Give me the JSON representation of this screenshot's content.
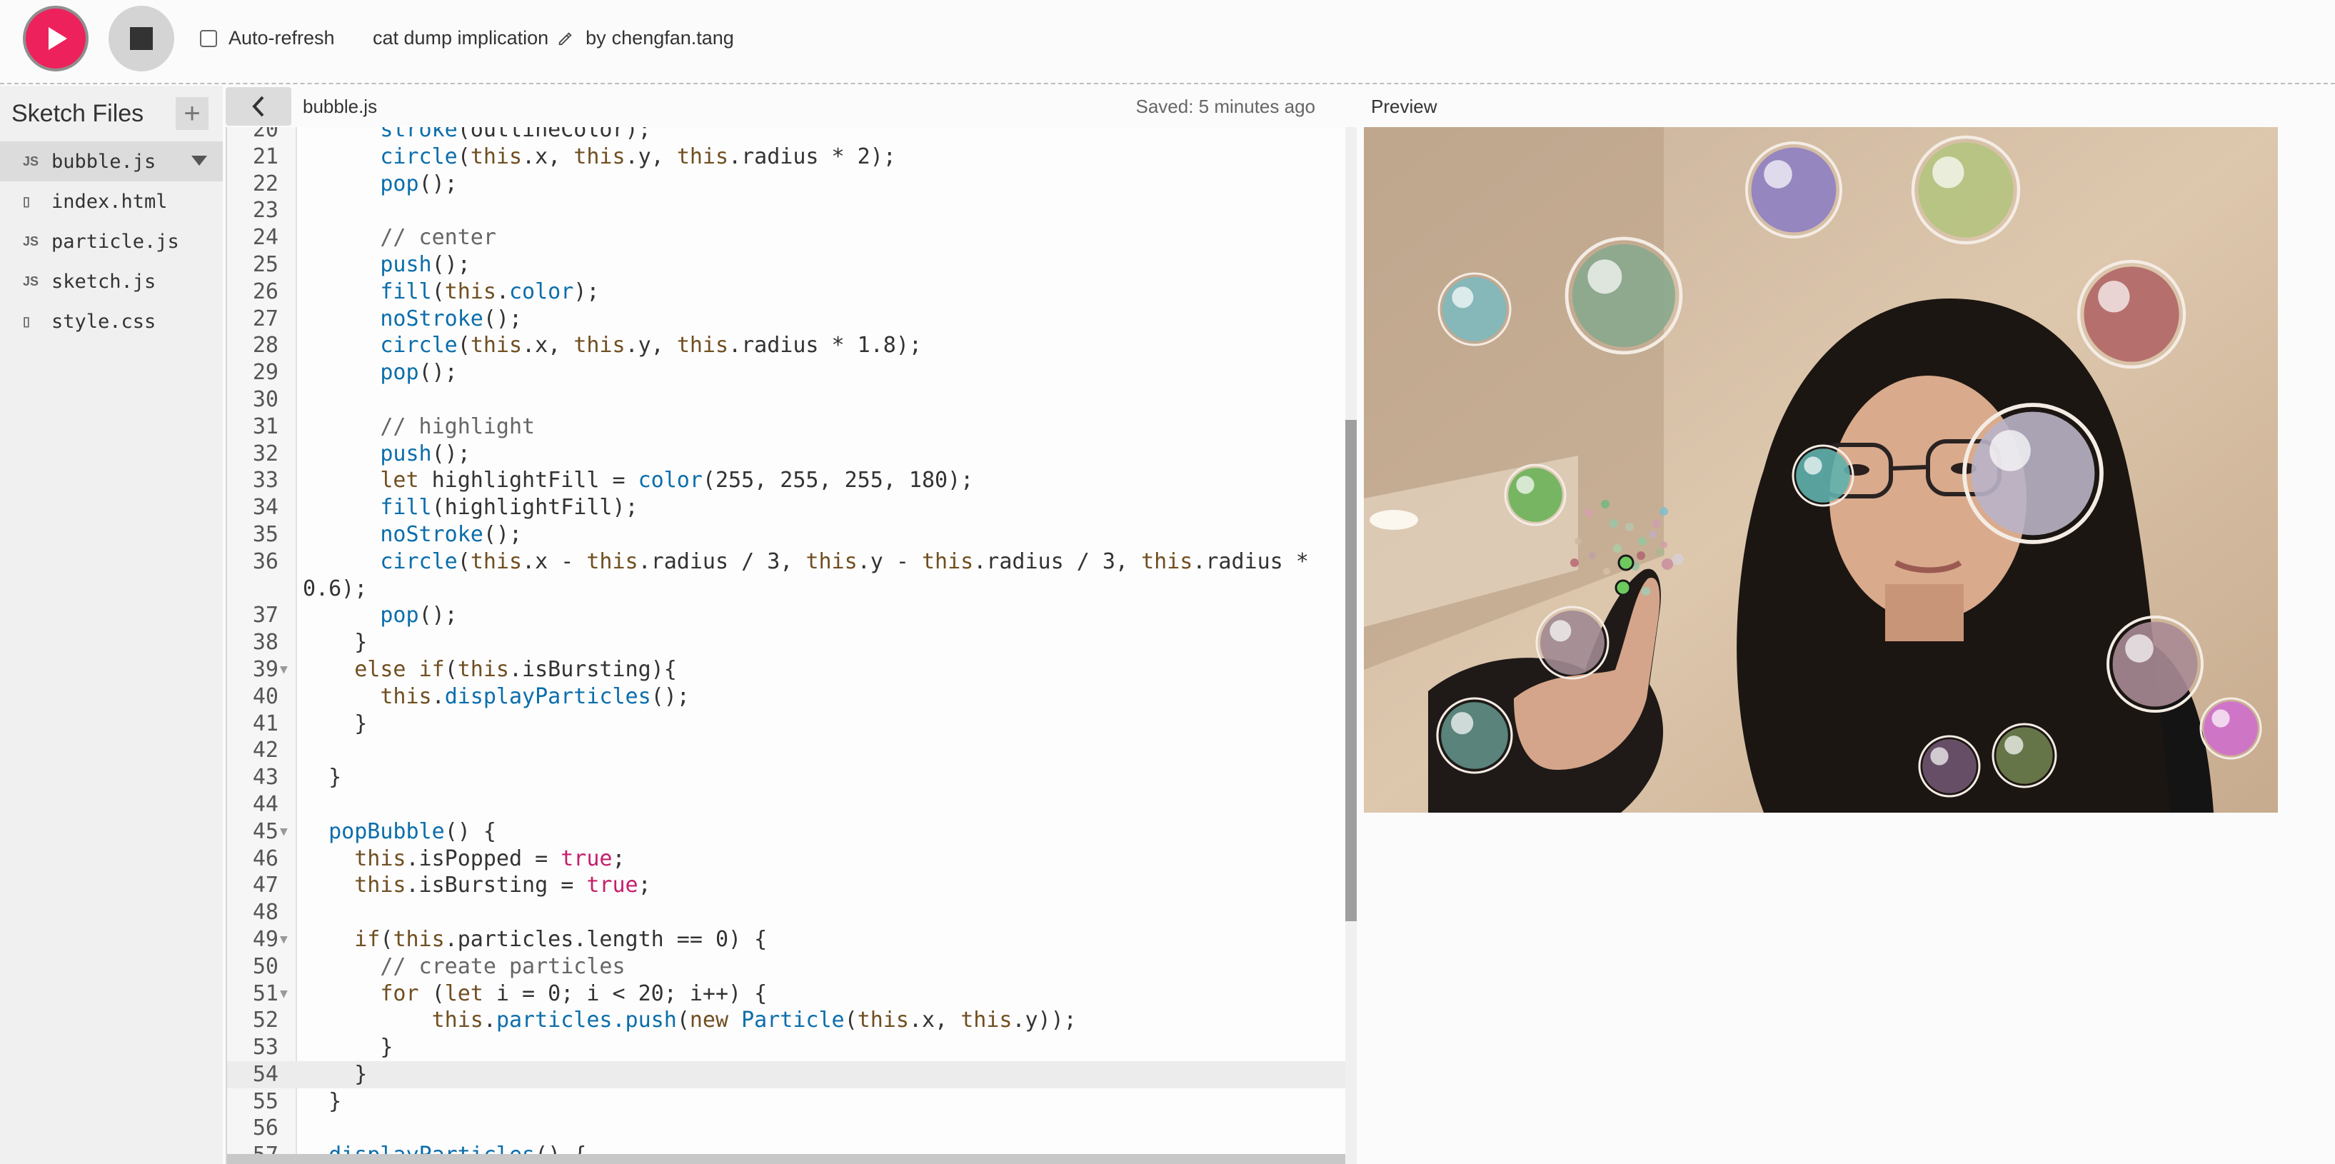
{
  "toolbar": {
    "play_icon": "play-icon",
    "stop_icon": "stop-icon",
    "auto_refresh_label": "Auto-refresh",
    "auto_refresh_checked": false,
    "project_name": "cat dump implication",
    "edit_icon": "pencil-icon",
    "by_label": "by",
    "author": "chengfan.tang"
  },
  "sidebar": {
    "title": "Sketch Files",
    "add_icon": "+",
    "files": [
      {
        "name": "bubble.js",
        "icon": "JS",
        "active": true
      },
      {
        "name": "index.html",
        "icon": "▯",
        "active": false
      },
      {
        "name": "particle.js",
        "icon": "JS",
        "active": false
      },
      {
        "name": "sketch.js",
        "icon": "JS",
        "active": false
      },
      {
        "name": "style.css",
        "icon": "▯",
        "active": false
      }
    ]
  },
  "editor": {
    "filename": "bubble.js",
    "saved_status": "Saved: 5 minutes ago",
    "lines": [
      {
        "n": "20",
        "text": "      stroke(outlineColor);"
      },
      {
        "n": "21",
        "text": "      circle(this.x, this.y, this.radius * 2);"
      },
      {
        "n": "22",
        "text": "      pop();"
      },
      {
        "n": "23",
        "text": ""
      },
      {
        "n": "24",
        "text": "      // center"
      },
      {
        "n": "25",
        "text": "      push();"
      },
      {
        "n": "26",
        "text": "      fill(this.color);"
      },
      {
        "n": "27",
        "text": "      noStroke();"
      },
      {
        "n": "28",
        "text": "      circle(this.x, this.y, this.radius * 1.8);"
      },
      {
        "n": "29",
        "text": "      pop();"
      },
      {
        "n": "30",
        "text": ""
      },
      {
        "n": "31",
        "text": "      // highlight"
      },
      {
        "n": "32",
        "text": "      push();"
      },
      {
        "n": "33",
        "text": "      let highlightFill = color(255, 255, 255, 180);"
      },
      {
        "n": "34",
        "text": "      fill(highlightFill);"
      },
      {
        "n": "35",
        "text": "      noStroke();"
      },
      {
        "n": "36",
        "text": "      circle(this.x - this.radius / 3, this.y - this.radius / 3, this.radius *"
      },
      {
        "n": "",
        "text": "0.6);"
      },
      {
        "n": "37",
        "text": "      pop();"
      },
      {
        "n": "38",
        "text": "    }"
      },
      {
        "n": "39",
        "text": "    else if(this.isBursting){",
        "fold": true
      },
      {
        "n": "40",
        "text": "      this.displayParticles();"
      },
      {
        "n": "41",
        "text": "    }"
      },
      {
        "n": "42",
        "text": ""
      },
      {
        "n": "43",
        "text": "  }"
      },
      {
        "n": "44",
        "text": ""
      },
      {
        "n": "45",
        "text": "  popBubble() {",
        "fold": true
      },
      {
        "n": "46",
        "text": "    this.isPopped = true;"
      },
      {
        "n": "47",
        "text": "    this.isBursting = true;"
      },
      {
        "n": "48",
        "text": ""
      },
      {
        "n": "49",
        "text": "    if(this.particles.length == 0) {",
        "fold": true
      },
      {
        "n": "50",
        "text": "      // create particles"
      },
      {
        "n": "51",
        "text": "      for (let i = 0; i < 20; i++) {",
        "fold": true
      },
      {
        "n": "52",
        "text": "          this.particles.push(new Particle(this.x, this.y));"
      },
      {
        "n": "53",
        "text": "      }"
      },
      {
        "n": "54",
        "text": "    }",
        "highlight": true
      },
      {
        "n": "55",
        "text": "  }"
      },
      {
        "n": "56",
        "text": ""
      },
      {
        "n": "57",
        "text": "  displayParticles() {"
      }
    ]
  },
  "preview": {
    "label": "Preview",
    "colors": {
      "accent": "#ed225d",
      "wall": "#d8c2a8",
      "hair": "#1c1612",
      "skin": "#d9aa8c",
      "hoodie": "#151414"
    },
    "bubbles": [
      {
        "color": "#8f7fc2",
        "name": "purple"
      },
      {
        "color": "#b5c47f",
        "name": "light-green"
      },
      {
        "color": "#88a88e",
        "name": "sage"
      },
      {
        "color": "#7fb8be",
        "name": "teal"
      },
      {
        "color": "#b06666",
        "name": "red"
      },
      {
        "color": "#b9b3c7",
        "name": "lavender"
      },
      {
        "color": "#6bb35a",
        "name": "green"
      },
      {
        "color": "#5fb0ad",
        "name": "aqua"
      },
      {
        "color": "#a08a92",
        "name": "mauve"
      },
      {
        "color": "#5f8f86",
        "name": "dark-teal"
      },
      {
        "color": "#a98a95",
        "name": "dusty-pink"
      },
      {
        "color": "#cf6fcc",
        "name": "magenta"
      },
      {
        "color": "#6f5570",
        "name": "plum"
      },
      {
        "color": "#6f7f4f",
        "name": "olive"
      }
    ]
  }
}
